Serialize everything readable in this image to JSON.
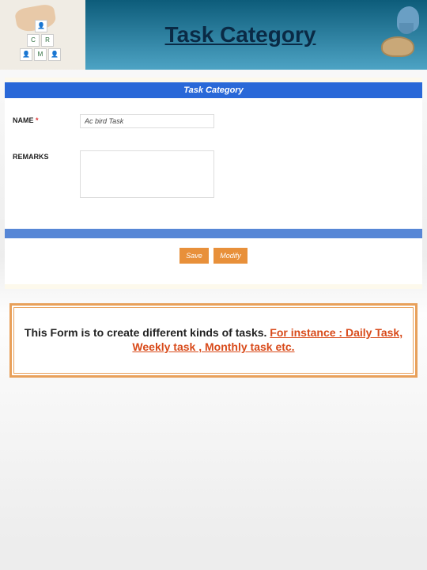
{
  "header": {
    "title": "Task Category"
  },
  "form": {
    "title_bar": "Task Category",
    "fields": {
      "name": {
        "label": "NAME",
        "required_marker": "*",
        "value": "Ac bird Task"
      },
      "remarks": {
        "label": "REMARKS",
        "value": ""
      }
    },
    "buttons": {
      "save": "Save",
      "modify": "Modify"
    }
  },
  "description": {
    "intro": "This  Form is to create different kinds of tasks. ",
    "highlight": "For instance : Daily Task, Weekly task , Monthly task etc."
  }
}
